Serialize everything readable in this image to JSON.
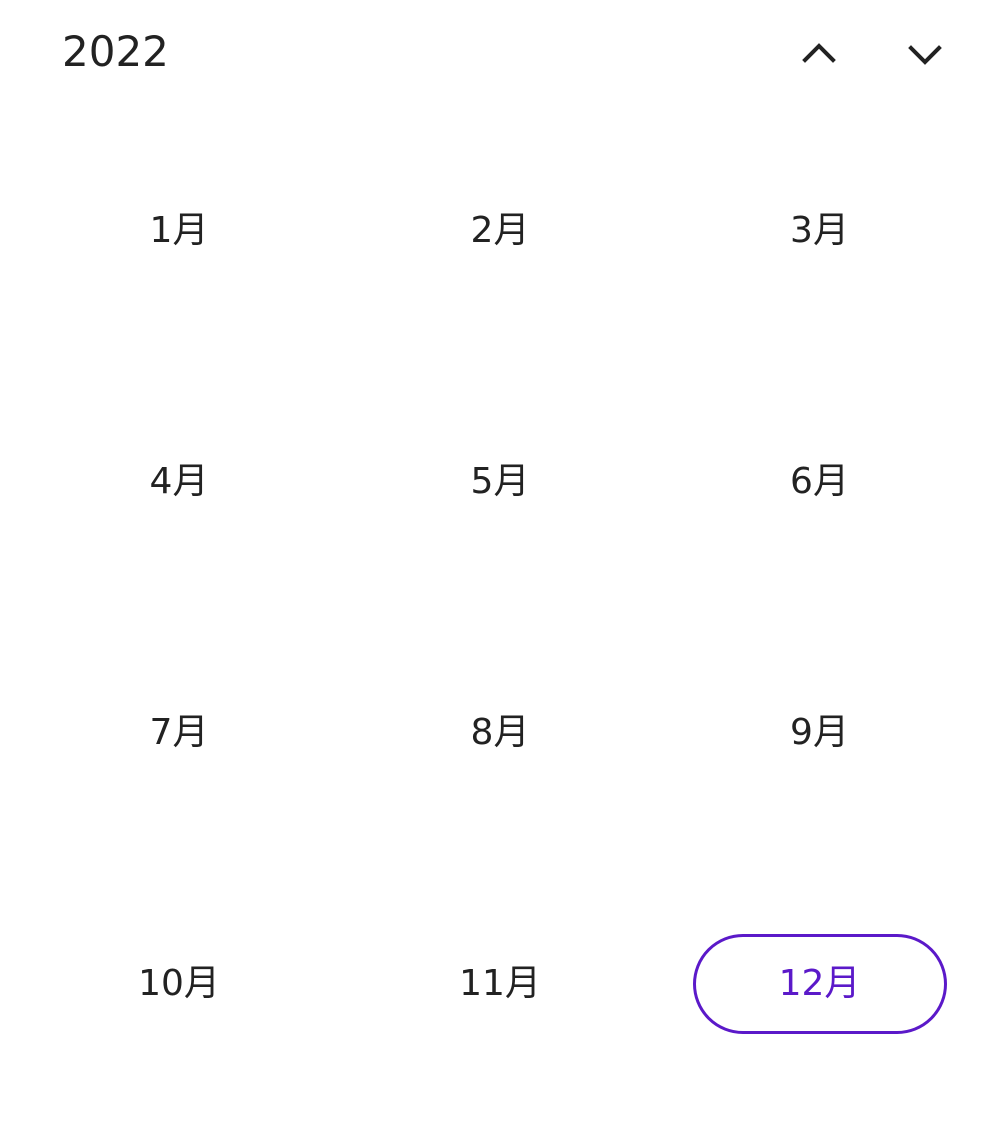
{
  "header": {
    "year": "2022",
    "prev_icon": "chevron-up-icon",
    "next_icon": "chevron-down-icon"
  },
  "months": [
    {
      "label": "1月",
      "selected": false
    },
    {
      "label": "2月",
      "selected": false
    },
    {
      "label": "3月",
      "selected": false
    },
    {
      "label": "4月",
      "selected": false
    },
    {
      "label": "5月",
      "selected": false
    },
    {
      "label": "6月",
      "selected": false
    },
    {
      "label": "7月",
      "selected": false
    },
    {
      "label": "8月",
      "selected": false
    },
    {
      "label": "9月",
      "selected": false
    },
    {
      "label": "10月",
      "selected": false
    },
    {
      "label": "11月",
      "selected": false
    },
    {
      "label": "12月",
      "selected": true
    }
  ],
  "colors": {
    "text": "#222222",
    "accent": "#5b19c9",
    "background": "#ffffff"
  }
}
